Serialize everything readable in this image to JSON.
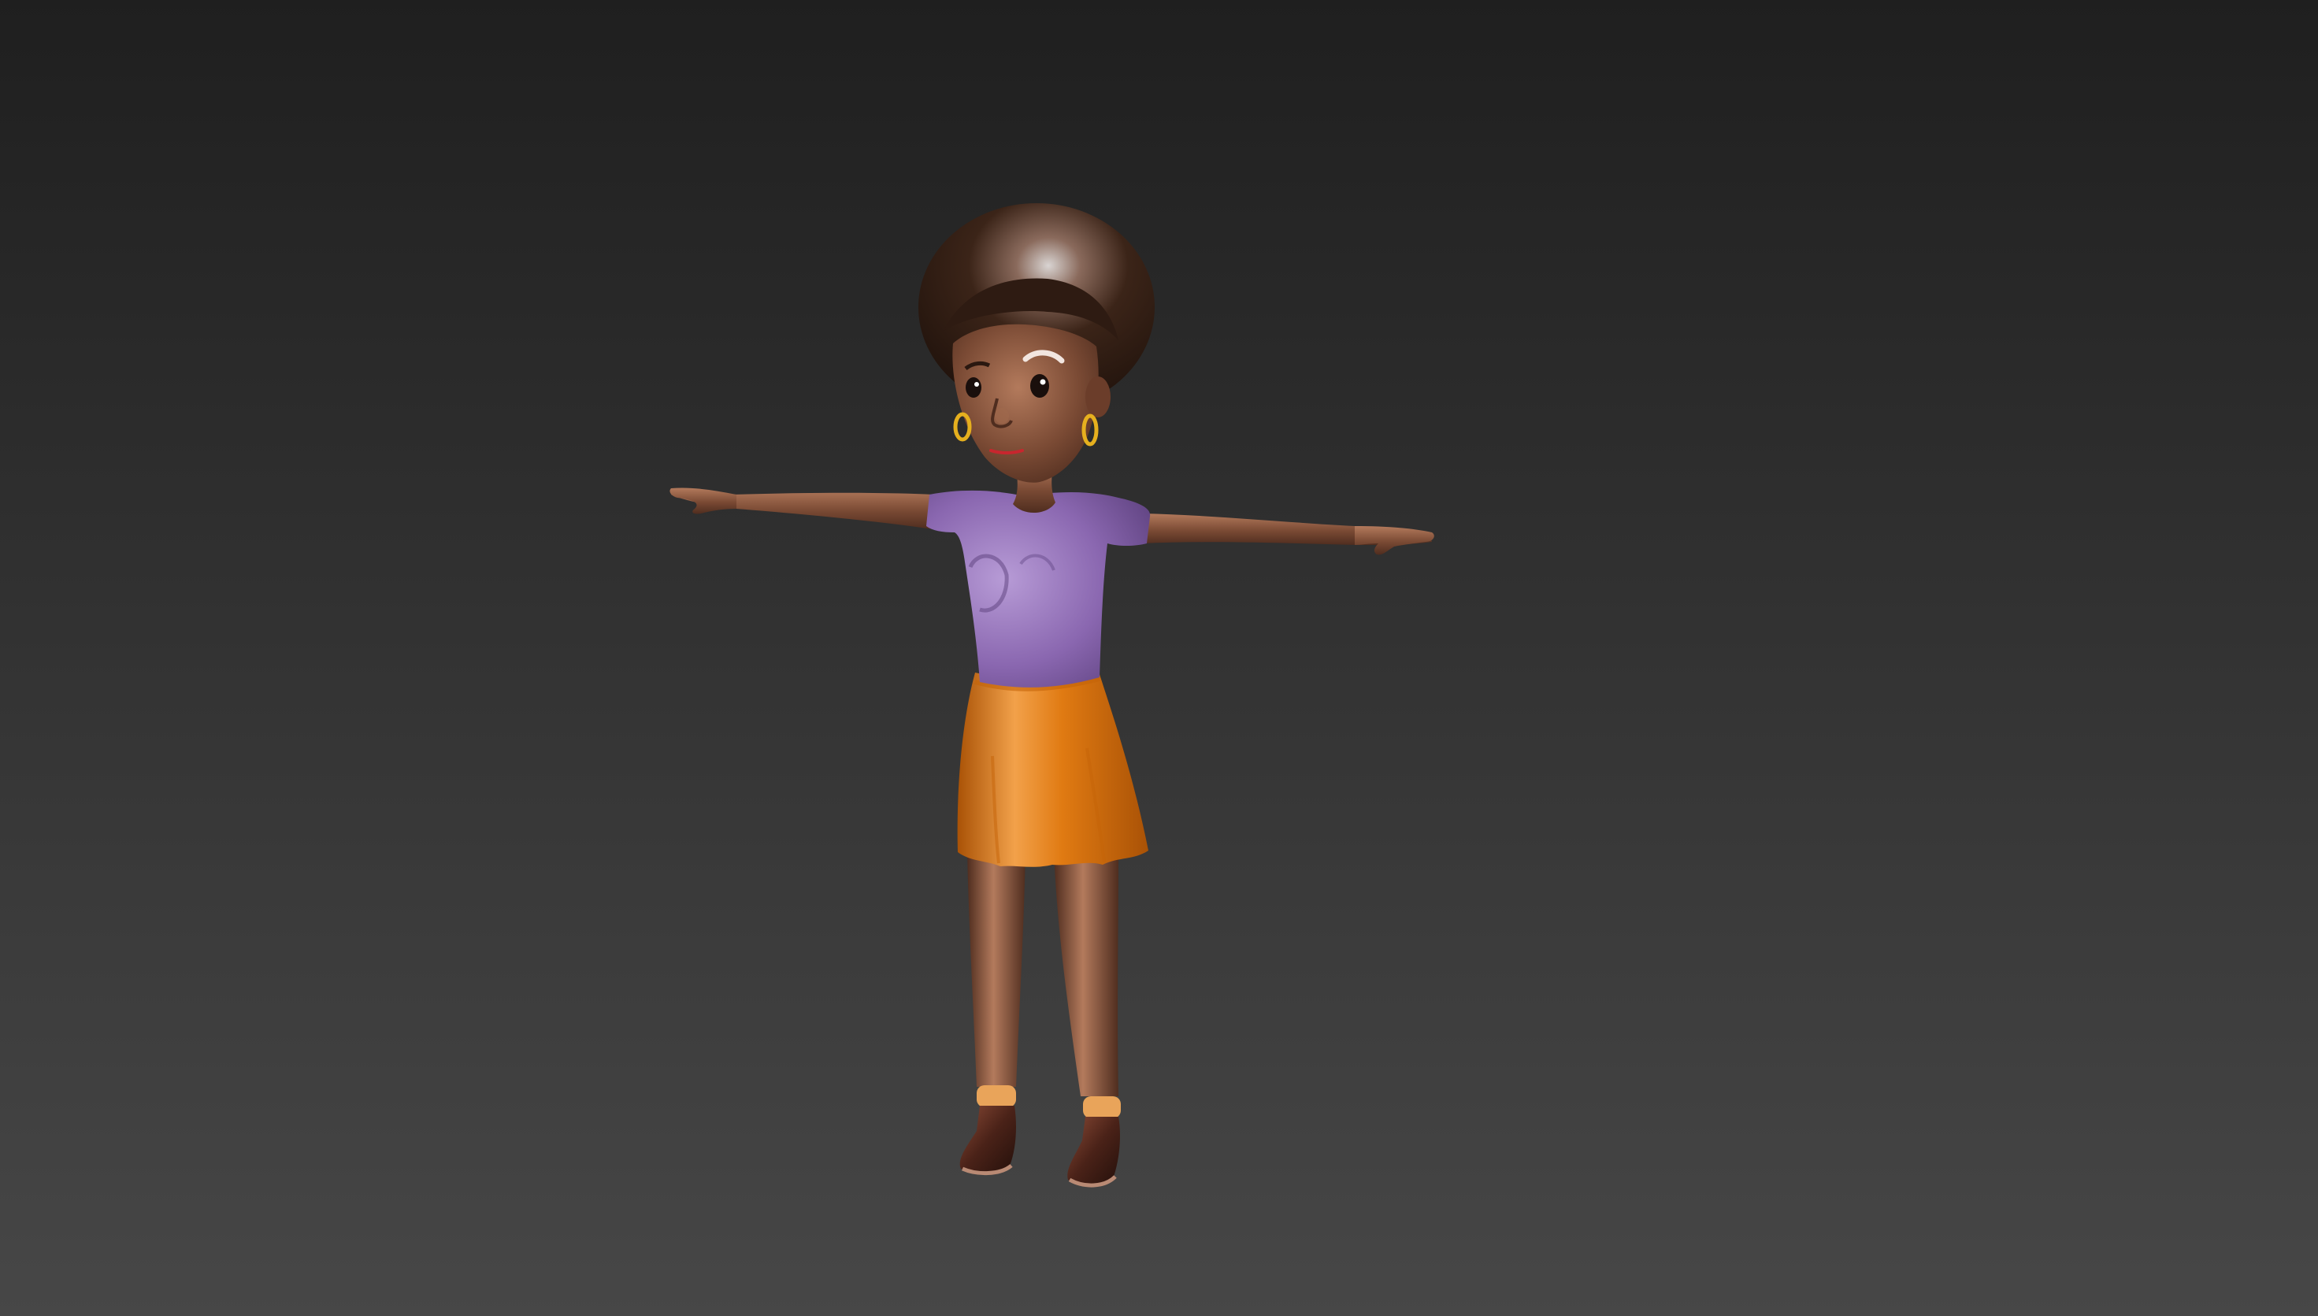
{
  "scene": {
    "background_top": "#1f1f1f",
    "background_bottom": "#474747"
  },
  "character": {
    "pose": "T-pose",
    "skin": "#7a4a34",
    "skin_highlight": "#b37a5c",
    "skin_shadow": "#4f2d1f",
    "hair": "#3b2418",
    "hair_highlight": "#d9d4d2",
    "shirt": "#8a67b0",
    "shirt_highlight": "#b79bd6",
    "skirt": "#e07a12",
    "skirt_highlight": "#f2a14a",
    "skirt_shadow": "#a95206",
    "shoes": "#4a2218",
    "socks": "#e9a45a",
    "earrings": "#e6b01e",
    "lips": "#c8262e",
    "eyes": "#1a0f0c"
  }
}
